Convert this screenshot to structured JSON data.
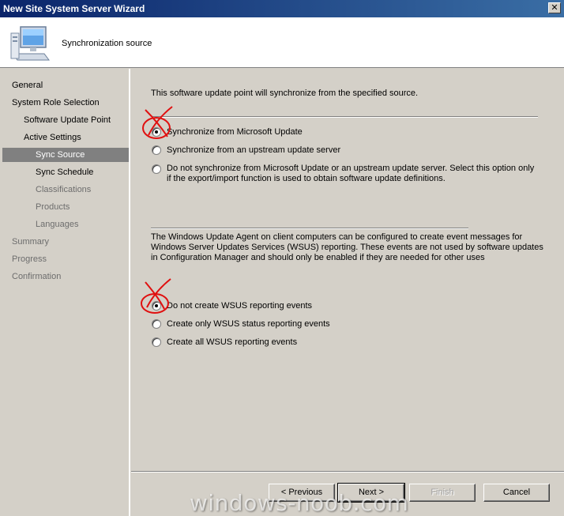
{
  "window": {
    "title": "New Site System Server Wizard",
    "close_glyph": "✕"
  },
  "header": {
    "title": "Synchronization source",
    "icon": "computer-icon"
  },
  "nav": {
    "items": [
      {
        "label": "General",
        "level": 0,
        "state": "disabled-done"
      },
      {
        "label": "System Role Selection",
        "level": 0,
        "state": "done"
      },
      {
        "label": "Software Update Point",
        "level": 1,
        "state": "done"
      },
      {
        "label": "Active Settings",
        "level": 1,
        "state": "done"
      },
      {
        "label": "Sync Source",
        "level": 2,
        "state": "selected"
      },
      {
        "label": "Sync Schedule",
        "level": 2,
        "state": "done"
      },
      {
        "label": "Classifications",
        "level": 2,
        "state": "disabled"
      },
      {
        "label": "Products",
        "level": 2,
        "state": "disabled"
      },
      {
        "label": "Languages",
        "level": 2,
        "state": "disabled"
      },
      {
        "label": "Summary",
        "level": 0,
        "state": "disabled"
      },
      {
        "label": "Progress",
        "level": 0,
        "state": "disabled"
      },
      {
        "label": "Confirmation",
        "level": 0,
        "state": "disabled"
      }
    ]
  },
  "content": {
    "intro": "This software update point will synchronize from the specified source.",
    "sync_options": [
      {
        "label": "Synchronize from Microsoft Update",
        "checked": true
      },
      {
        "label": "Synchronize from an upstream update server",
        "checked": false
      },
      {
        "label": "Do not synchronize from Microsoft Update or an upstream update server. Select this option only if the export/import function is used to obtain software update definitions.",
        "checked": false
      }
    ],
    "wsus_description": "The Windows Update Agent on client computers can be configured to create event messages for Windows Server Updates Services (WSUS) reporting. These events are not used by software updates in Configuration Manager and should only be enabled if they are needed for other uses",
    "wsus_options": [
      {
        "label": "Do not create WSUS reporting events",
        "checked": true
      },
      {
        "label": "Create only WSUS status reporting events",
        "checked": false
      },
      {
        "label": "Create all WSUS reporting events",
        "checked": false
      }
    ]
  },
  "buttons": {
    "previous": "< Previous",
    "next": "Next >",
    "finish": "Finish",
    "cancel": "Cancel"
  },
  "watermark": "windows-noob.com",
  "colors": {
    "titlebar_start": "#0a246a",
    "titlebar_end": "#3a6ea5",
    "selection": "#808080",
    "annotation": "#e01010"
  }
}
